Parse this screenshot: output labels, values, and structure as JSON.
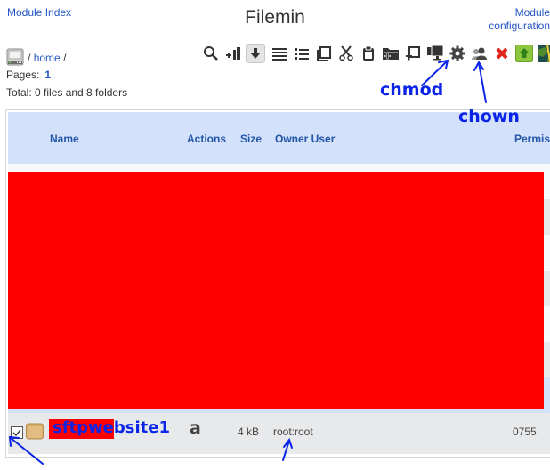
{
  "header": {
    "module_index": "Module Index",
    "title": "Filemin",
    "module_config_line1": "Module",
    "module_config_line2": "configuration"
  },
  "breadcrumb": {
    "root_icon": "hard-drive-icon",
    "sep1": "/",
    "home": "home",
    "sep2": "/"
  },
  "pages": {
    "label": "Pages:",
    "current": "1"
  },
  "total": "Total: 0 files and 8 folders",
  "toolbar": [
    {
      "name": "search",
      "icon": "search-icon"
    },
    {
      "name": "new-file",
      "icon": "new-file-icon"
    },
    {
      "name": "download",
      "icon": "download-icon",
      "active": true
    },
    {
      "name": "select-all",
      "icon": "select-all-icon"
    },
    {
      "name": "invert-selection",
      "icon": "list-icon"
    },
    {
      "name": "copy",
      "icon": "copy-icon"
    },
    {
      "name": "cut",
      "icon": "cut-icon"
    },
    {
      "name": "paste",
      "icon": "paste-icon"
    },
    {
      "name": "new-folder",
      "icon": "new-folder-icon"
    },
    {
      "name": "create-file",
      "icon": "create-file-icon"
    },
    {
      "name": "remote-download",
      "icon": "monitor-icon"
    },
    {
      "name": "chmod",
      "icon": "gear-icon"
    },
    {
      "name": "chown",
      "icon": "users-icon"
    },
    {
      "name": "delete",
      "icon": "delete-icon"
    },
    {
      "name": "upload",
      "icon": "upload-icon"
    },
    {
      "name": "bookmarks",
      "icon": "map-icon"
    }
  ],
  "annotations": {
    "chmod": "chmod",
    "chown": "chown"
  },
  "table": {
    "columns": [
      "Name",
      "Actions",
      "Size",
      "Owner User",
      "Permis"
    ],
    "rows": [
      {
        "name": "sftpwebsite1",
        "action": "a",
        "size": "4 kB",
        "owner": "root:root",
        "permissions": "0755",
        "checked": true
      }
    ]
  },
  "colors": {
    "link": "#2356c4",
    "header_bg": "#d3e1fb",
    "annotation": "#0b25e8",
    "redaction": "#ff0000"
  }
}
